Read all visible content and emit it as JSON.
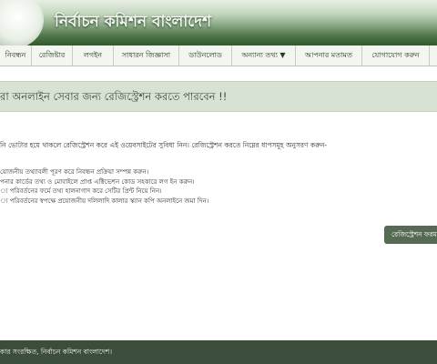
{
  "header": {
    "site_title": "নির্বাচন কমিশন বাংলাদেশ"
  },
  "nav": {
    "items": [
      {
        "label": "নিবন্ধন"
      },
      {
        "label": "রেজিষ্টার"
      },
      {
        "label": "লগইন"
      },
      {
        "label": "সাধারন জিজ্ঞাসা"
      },
      {
        "label": "ডাউনলোড"
      },
      {
        "label": "অন্যান্য তথ্য ▼"
      },
      {
        "label": "আপনার মতামত"
      },
      {
        "label": "যোগাযোগ করুন"
      },
      {
        "label": ""
      }
    ]
  },
  "notice": {
    "text": "রা অনলাইন সেবার জন্য রেজিস্ট্রেশন করতে পারবেন !!"
  },
  "main": {
    "intro": "নি ভোটার হয়ে থাকলে রেজিস্ট্রেশন করে এই ওয়েবসাইটের সুবিধা নিন। রেজিস্ট্রেশন করতে নিম্নের ধাপসমূহ অনুসরণ করুন-",
    "steps": [
      "য়োজনীয় তথ্যাবলী পূরণ করে নিবন্ধন প্রক্রিয়া সম্পন্ন করুন।",
      "পনার কার্ডের তথ্য ও মোবাইলে প্রাপ্ত এক্টিভেশন কোড সহকারে লগ ইন করুন।",
      "্য পরিবর্তনের ফর্মে তথ্য হালনাগাদ করে সেটির প্রিন্ট নিয়ে নিন।",
      "্য পরিবর্তনের স্বপক্ষে প্রয়োজনীয় দলিলাদি কালার স্ক্যান কপি অনলাইনে জমা দিন।"
    ],
    "register_button": "রেজিস্ট্রেশন ফরম"
  },
  "footer": {
    "text": "কার সংরক্ষিত, নির্বাচন কমিশন বাংলাদেশ।"
  }
}
